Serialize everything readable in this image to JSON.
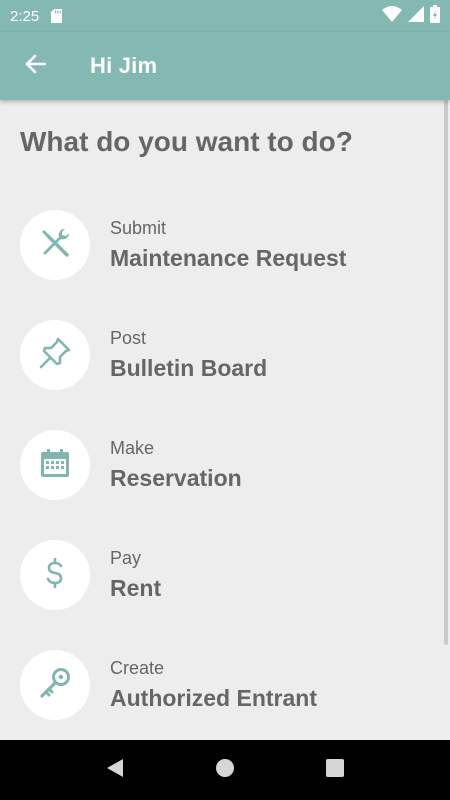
{
  "status_bar": {
    "time": "2:25",
    "icons": [
      "sd-card-icon",
      "wifi-icon",
      "cell-signal-icon",
      "battery-icon"
    ]
  },
  "app_bar": {
    "title": "Hi Jim",
    "back_icon": "arrow-back-icon"
  },
  "main": {
    "heading": "What do you want to do?",
    "actions": [
      {
        "sub": "Submit",
        "title": "Maintenance Request",
        "icon": "tools-icon"
      },
      {
        "sub": "Post",
        "title": "Bulletin Board",
        "icon": "pushpin-icon"
      },
      {
        "sub": "Make",
        "title": "Reservation",
        "icon": "calendar-icon"
      },
      {
        "sub": "Pay",
        "title": "Rent",
        "icon": "dollar-icon"
      },
      {
        "sub": "Create",
        "title": "Authorized Entrant",
        "icon": "key-icon"
      }
    ]
  },
  "colors": {
    "accent": "#84b8b2",
    "icon": "#7fb6af",
    "text": "#666666",
    "background": "#ededed"
  },
  "nav_bar": {
    "buttons": [
      "back-triangle-icon",
      "home-circle-icon",
      "recents-square-icon"
    ]
  }
}
